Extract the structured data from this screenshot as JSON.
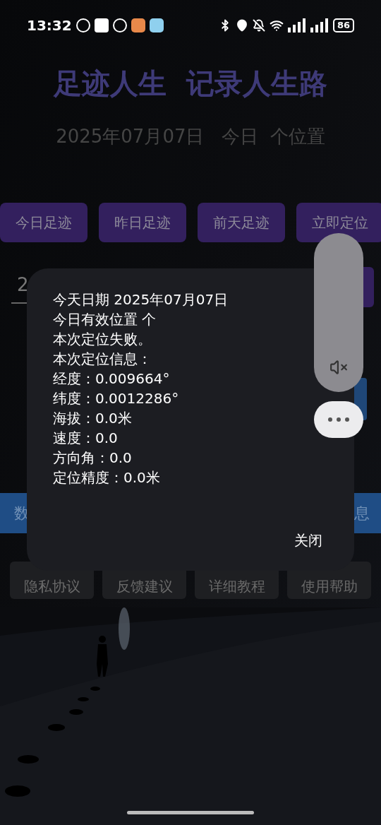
{
  "status_bar": {
    "time": "13:32",
    "battery": "86"
  },
  "header": {
    "title": "足迹人生  记录人生路",
    "subtitle": "2025年07月07日   今日  个位置"
  },
  "nav_buttons": [
    "今日足迹",
    "昨日足迹",
    "前天足迹",
    "立即定位"
  ],
  "date_field": {
    "value": "2"
  },
  "action_buttons": [
    "数",
    "息"
  ],
  "footer_buttons": [
    "隐私协议",
    "反馈建议",
    "详细教程",
    "使用帮助"
  ],
  "dialog": {
    "lines": [
      "今天日期 2025年07月07日",
      "今日有效位置  个",
      "本次定位失败。",
      "本次定位信息：",
      "经度：0.009664°",
      "纬度：0.0012286°",
      "海拔：0.0米",
      "速度：0.0",
      "方向角：0.0",
      "定位精度：0.0米"
    ],
    "close": "关闭"
  },
  "volume_panel": {
    "muted": true
  }
}
